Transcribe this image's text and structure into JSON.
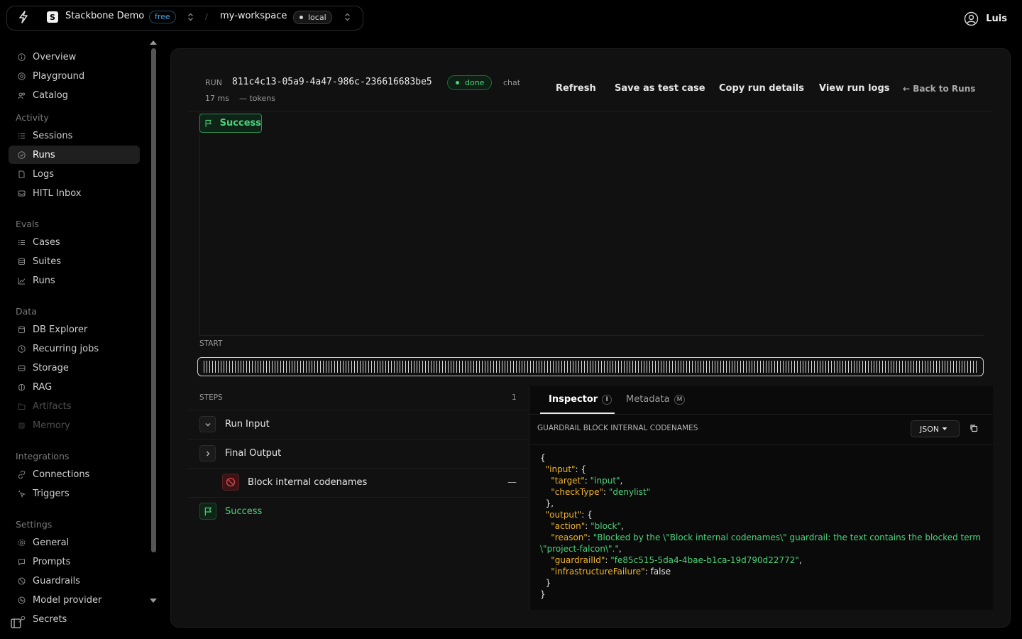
{
  "topbar": {
    "org_name": "Stackbone Demo",
    "org_logo_letter": "S",
    "plan_badge": "free",
    "workspace_name": "my-workspace",
    "env_badge": "local",
    "user_name": "Luis"
  },
  "sidebar": {
    "items_top": [
      {
        "label": "Overview",
        "icon": "info-circle-icon"
      },
      {
        "label": "Playground",
        "icon": "target-icon"
      },
      {
        "label": "Catalog",
        "icon": "users-icon"
      }
    ],
    "activity_label": "Activity",
    "activity": [
      {
        "label": "Sessions",
        "icon": "list-icon"
      },
      {
        "label": "Runs",
        "icon": "clock-check-icon",
        "active": true
      },
      {
        "label": "Logs",
        "icon": "doc-icon"
      },
      {
        "label": "HITL Inbox",
        "icon": "inbox-icon"
      }
    ],
    "evals_label": "Evals",
    "evals": [
      {
        "label": "Cases",
        "icon": "list-icon"
      },
      {
        "label": "Suites",
        "icon": "stack-icon"
      },
      {
        "label": "Runs",
        "icon": "chart-line-icon"
      }
    ],
    "data_label": "Data",
    "data": [
      {
        "label": "DB Explorer",
        "icon": "database-icon"
      },
      {
        "label": "Recurring jobs",
        "icon": "clock-icon"
      },
      {
        "label": "Storage",
        "icon": "disk-icon"
      },
      {
        "label": "RAG",
        "icon": "brain-icon"
      },
      {
        "label": "Artifacts",
        "icon": "folder-icon",
        "disabled": true
      },
      {
        "label": "Memory",
        "icon": "cpu-icon",
        "disabled": true
      }
    ],
    "integrations_label": "Integrations",
    "integrations": [
      {
        "label": "Connections",
        "icon": "link-icon"
      },
      {
        "label": "Triggers",
        "icon": "cursor-click-icon"
      }
    ],
    "settings_label": "Settings",
    "settings": [
      {
        "label": "General",
        "icon": "gear-icon"
      },
      {
        "label": "Prompts",
        "icon": "chat-icon"
      },
      {
        "label": "Guardrails",
        "icon": "ban-icon"
      },
      {
        "label": "Model provider",
        "icon": "model-icon"
      },
      {
        "label": "Secrets",
        "icon": "key-icon"
      }
    ]
  },
  "run": {
    "label": "RUN",
    "id": "811c4c13-05a9-4a47-986c-236616683be5",
    "status": "done",
    "kind": "chat",
    "duration": "17 ms",
    "tokens": "— tokens",
    "actions": {
      "refresh": "Refresh",
      "save_test_case": "Save as test case",
      "copy_details": "Copy run details",
      "view_logs": "View run logs",
      "back": "← Back to Runs"
    }
  },
  "graph": {
    "node_label": "Success",
    "start_label": "START"
  },
  "steps": {
    "header": "STEPS",
    "count": "1",
    "rows": [
      {
        "label": "Run Input"
      },
      {
        "label": "Final Output"
      },
      {
        "label": "Block internal codenames",
        "trail": "—"
      },
      {
        "label": "Success"
      }
    ]
  },
  "inspector": {
    "tab_inspector": "Inspector",
    "tab_inspector_key": "I",
    "tab_metadata": "Metadata",
    "tab_metadata_key": "M",
    "title": "GUARDRAIL BLOCK INTERNAL CODENAMES",
    "format": "JSON",
    "json": {
      "input_key": "\"input\"",
      "target_key": "\"target\"",
      "target_val": "\"input\"",
      "checktype_key": "\"checkType\"",
      "checktype_val": "\"denylist\"",
      "output_key": "\"output\"",
      "action_key": "\"action\"",
      "action_val": "\"block\"",
      "reason_key": "\"reason\"",
      "reason_val": "\"Blocked by the \\\"Block internal codenames\\\" guardrail: the text contains the blocked term \\\"project-falcon\\\".\"",
      "guardrail_key": "\"guardrailId\"",
      "guardrail_val": "\"fe85c515-5da4-4bae-b1ca-19d790d22772\"",
      "infra_key": "\"infrastructureFailure\"",
      "infra_val": "false"
    }
  },
  "colors": {
    "accent_green": "#4cd37a",
    "json_key": "#f0b429",
    "badge_blue": "#4aa3df",
    "block_red": "#e0474c"
  }
}
